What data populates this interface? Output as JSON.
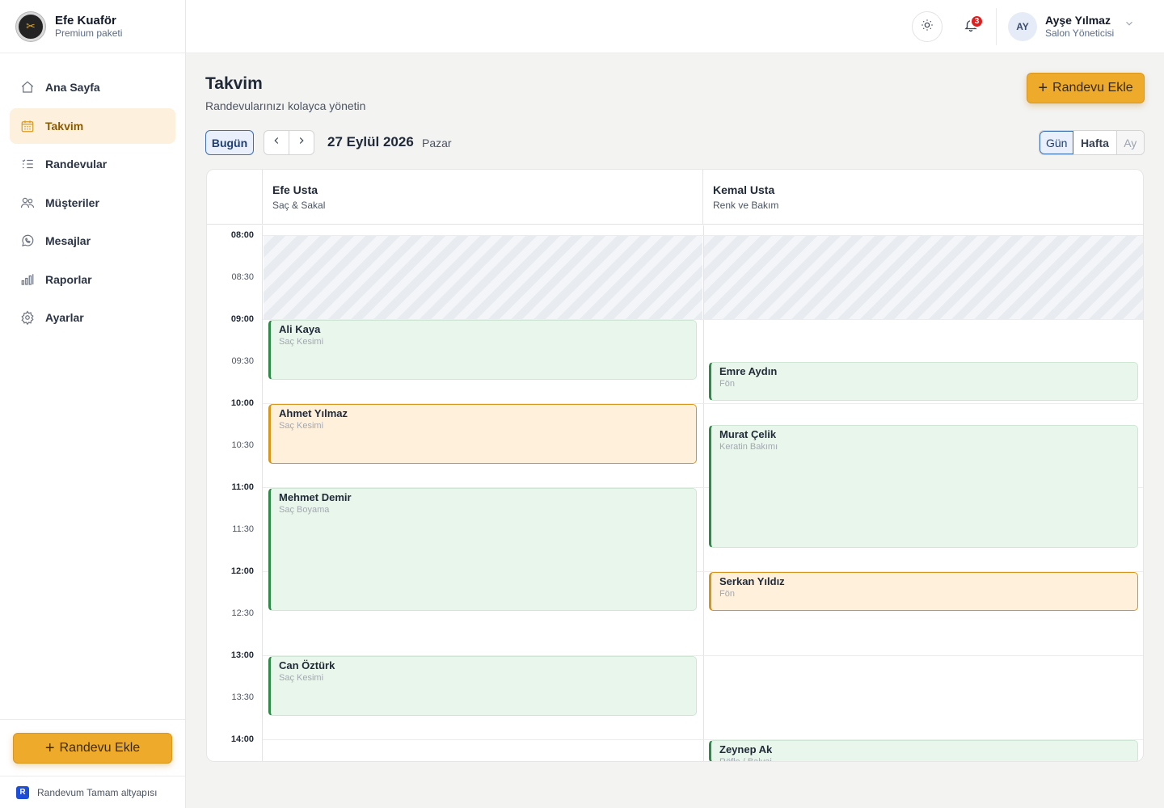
{
  "brand": {
    "name": "Efe Kuaför",
    "plan": "Premium paketi",
    "logo_icon": "scissors-icon"
  },
  "sidebar": {
    "items": [
      {
        "label": "Ana Sayfa",
        "icon": "home-icon",
        "active": false
      },
      {
        "label": "Takvim",
        "icon": "calendar-icon",
        "active": true
      },
      {
        "label": "Randevular",
        "icon": "list-icon",
        "active": false
      },
      {
        "label": "Müşteriler",
        "icon": "users-icon",
        "active": false
      },
      {
        "label": "Mesajlar",
        "icon": "whatsapp-icon",
        "active": false
      },
      {
        "label": "Raporlar",
        "icon": "bar-chart-icon",
        "active": false
      },
      {
        "label": "Ayarlar",
        "icon": "gear-icon",
        "active": false
      }
    ],
    "add_button": "Randevu Ekle",
    "footer": "Randevum Tamam altyapısı"
  },
  "topbar": {
    "notification_count": "3",
    "user": {
      "initials": "AY",
      "name": "Ayşe Yılmaz",
      "role": "Salon Yöneticisi"
    }
  },
  "page": {
    "title": "Takvim",
    "subtitle": "Randevularınızı kolayca yönetin",
    "add_button": "Randevu Ekle"
  },
  "toolbar": {
    "today": "Bugün",
    "date": "27 Eylül 2026",
    "weekday": "Pazar",
    "views": [
      "Gün",
      "Hafta",
      "Ay"
    ],
    "active_view": "Gün"
  },
  "calendar": {
    "staff": [
      {
        "name": "Efe Usta",
        "specialty": "Saç & Sakal"
      },
      {
        "name": "Kemal Usta",
        "specialty": "Renk ve Bakım"
      }
    ],
    "times": [
      "08:00",
      "08:30",
      "09:00",
      "09:30",
      "10:00",
      "10:30",
      "11:00",
      "11:30",
      "12:00",
      "12:30",
      "13:00",
      "13:30",
      "14:00"
    ],
    "appointments": [
      {
        "staff": 0,
        "name": "Ali Kaya",
        "service": "Saç Kesimi",
        "start": "09:00",
        "end": "09:45",
        "status": "confirmed"
      },
      {
        "staff": 0,
        "name": "Ahmet Yılmaz",
        "service": "Saç Kesimi",
        "start": "10:00",
        "end": "10:45",
        "status": "pending"
      },
      {
        "staff": 0,
        "name": "Mehmet Demir",
        "service": "Saç Boyama",
        "start": "11:00",
        "end": "12:30",
        "status": "confirmed"
      },
      {
        "staff": 0,
        "name": "Can Öztürk",
        "service": "Saç Kesimi",
        "start": "13:00",
        "end": "13:45",
        "status": "confirmed"
      },
      {
        "staff": 1,
        "name": "Emre Aydın",
        "service": "Fön",
        "start": "09:30",
        "end": "10:00",
        "status": "confirmed"
      },
      {
        "staff": 1,
        "name": "Murat Çelik",
        "service": "Keratin Bakımı",
        "start": "10:15",
        "end": "11:45",
        "status": "confirmed"
      },
      {
        "staff": 1,
        "name": "Serkan Yıldız",
        "service": "Fön",
        "start": "12:00",
        "end": "12:30",
        "status": "pending"
      },
      {
        "staff": 1,
        "name": "Zeynep Ak",
        "service": "Röfle / Balyaj",
        "start": "14:00",
        "end": "15:30",
        "status": "confirmed"
      }
    ]
  },
  "colors": {
    "accent": "#eeaa2b",
    "confirmed": "#2e8b47",
    "pending": "#d8971a",
    "selected": "#3d6fb3"
  }
}
